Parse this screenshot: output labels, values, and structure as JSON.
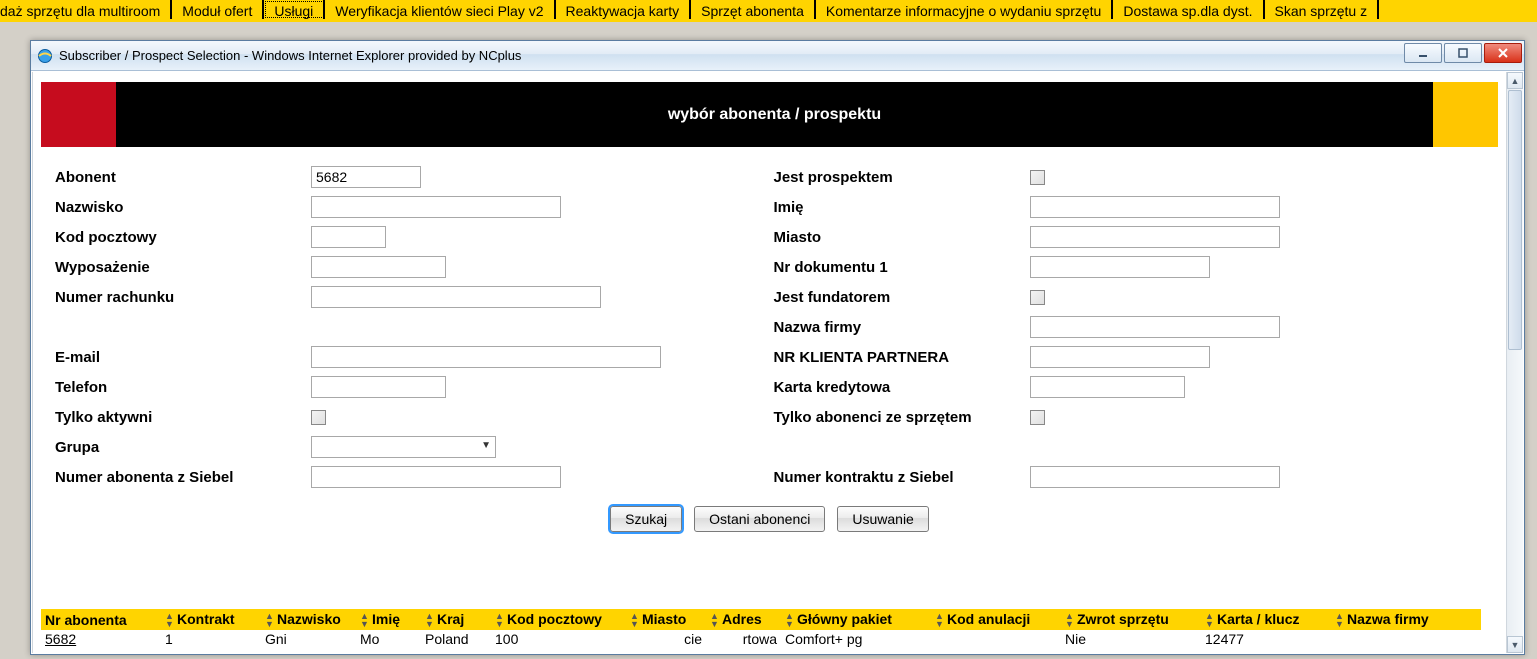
{
  "topTabs": {
    "items": [
      "daż sprzętu dla multiroom",
      "Moduł ofert",
      "Usługi",
      "Weryfikacja klientów sieci Play v2",
      "Reaktywacja karty",
      "Sprzęt abonenta",
      "Komentarze informacyjne o wydaniu sprzętu",
      "Dostawa sp.dla dyst.",
      "Skan sprzętu z"
    ],
    "selectedIndex": 2
  },
  "window": {
    "title": "Subscriber / Prospect Selection - Windows Internet Explorer provided by NCplus"
  },
  "banner": {
    "title": "wybór abonenta / prospektu"
  },
  "form": {
    "left": {
      "abonent_label": "Abonent",
      "abonent_value": "5682",
      "nazwisko_label": "Nazwisko",
      "nazwisko_value": "",
      "kod_label": "Kod pocztowy",
      "kod_value": "",
      "wypos_label": "Wyposażenie",
      "wypos_value": "",
      "numer_rach_label": "Numer rachunku",
      "numer_rach_value": "",
      "email_label": "E-mail",
      "email_value": "",
      "telefon_label": "Telefon",
      "telefon_value": "",
      "tylko_aktywni_label": "Tylko aktywni",
      "grupa_label": "Grupa",
      "grupa_value": "",
      "siebel_abon_label": "Numer abonenta z Siebel",
      "siebel_abon_value": ""
    },
    "right": {
      "jest_prosp_label": "Jest prospektem",
      "imie_label": "Imię",
      "imie_value": "",
      "miasto_label": "Miasto",
      "miasto_value": "",
      "nr_dok_label": "Nr dokumentu 1",
      "nr_dok_value": "",
      "jest_fund_label": "Jest fundatorem",
      "nazwa_firmy_label": "Nazwa firmy",
      "nazwa_firmy_value": "",
      "nr_klienta_label": "NR KLIENTA PARTNERA",
      "nr_klienta_value": "",
      "karta_kred_label": "Karta kredytowa",
      "karta_kred_value": "",
      "tylko_abon_sprz_label": "Tylko abonenci ze sprzętem",
      "siebel_kontrakt_label": "Numer kontraktu z Siebel",
      "siebel_kontrakt_value": ""
    }
  },
  "buttons": {
    "szukaj": "Szukaj",
    "ostatni": "Ostani abonenci",
    "usuwanie": "Usuwanie"
  },
  "results": {
    "headers": [
      "Nr abonenta",
      "Kontrakt",
      "Nazwisko",
      "Imię",
      "Kraj",
      "Kod pocztowy",
      "Miasto",
      "Adres",
      "Główny pakiet",
      "Kod anulacji",
      "Zwrot sprzętu",
      "Karta / klucz",
      "Nazwa firmy"
    ],
    "row": {
      "nr_abonenta": "5682",
      "kontrakt": "1",
      "nazwisko": "Gni",
      "imie": "Mo",
      "kraj": "Poland",
      "kod": "100",
      "miasto": "cie",
      "adres": "rtowa",
      "pakiet": "Comfort+ pg",
      "kod_anul": "",
      "zwrot": "Nie",
      "karta": "12477",
      "firma": ""
    }
  }
}
